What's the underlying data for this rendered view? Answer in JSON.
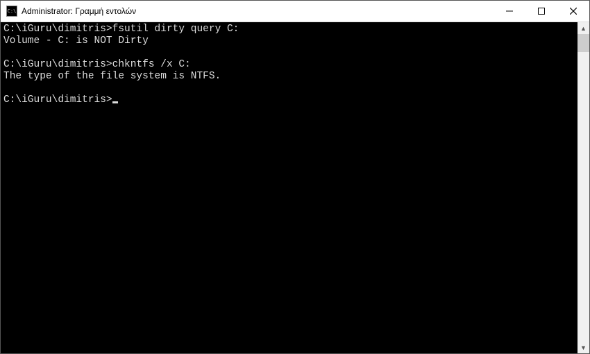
{
  "window": {
    "title": "Administrator: Γραμμή εντολών",
    "icon_label": "cmd-icon",
    "controls": {
      "minimize": "—",
      "maximize": "□",
      "close": "✕"
    }
  },
  "terminal": {
    "lines": [
      {
        "prompt": "C:\\iGuru\\dimitris>",
        "command": "fsutil dirty query C:"
      },
      {
        "output": "Volume - C: is NOT Dirty"
      },
      {
        "output": ""
      },
      {
        "prompt": "C:\\iGuru\\dimitris>",
        "command": "chkntfs /x C:"
      },
      {
        "output": "The type of the file system is NTFS."
      },
      {
        "output": ""
      },
      {
        "prompt": "C:\\iGuru\\dimitris>",
        "command": "",
        "cursor": true
      }
    ]
  },
  "scrollbar": {
    "up": "▲",
    "down": "▼"
  }
}
